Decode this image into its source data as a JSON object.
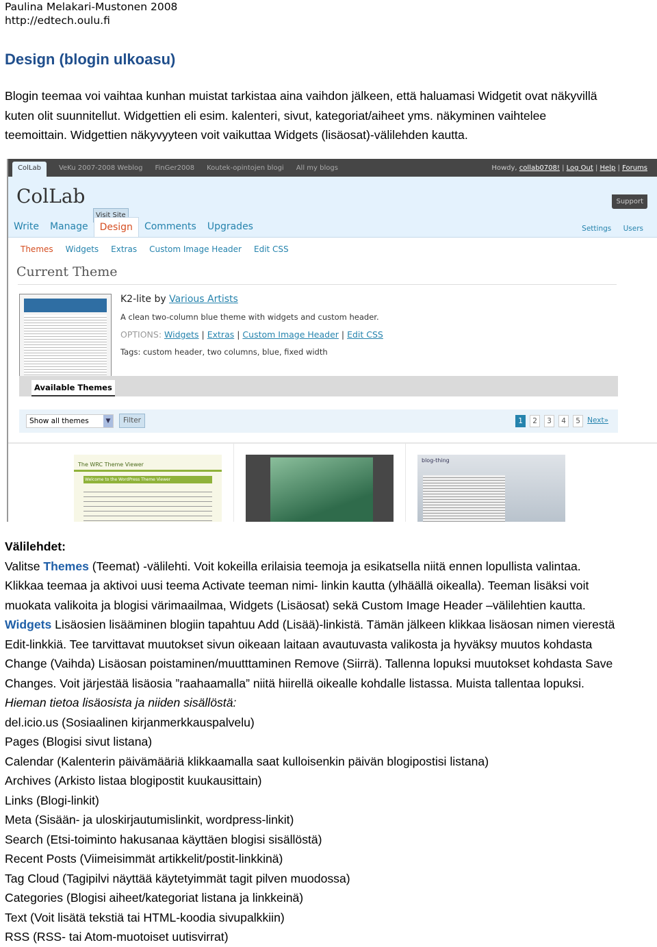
{
  "header": {
    "author": "Paulina Melakari-Mustonen 2008",
    "url": "http://edtech.oulu.fi"
  },
  "title": "Design (blogin ulkoasu)",
  "intro": [
    "Blogin teemaa voi vaihtaa kunhan muistat tarkistaa aina vaihdon jälkeen, että haluamasi Widgetit ovat näkyvillä",
    "kuten olit suunnitellut. Widgettien eli esim. kalenteri, sivut, kategoriat/aiheet yms. näkyminen vaihtelee",
    "teemoittain. Widgettien näkyvyyteen voit vaikuttaa Widgets (lisäosat)-välilehden kautta."
  ],
  "screenshot": {
    "topbar": {
      "tabs": [
        "ColLab",
        "VeKu 2007-2008 Weblog",
        "FinGer2008",
        "Koutek-opintojen blogi",
        "All my blogs"
      ],
      "howdy": "Howdy,",
      "user": "collab0708!",
      "logout": "Log Out",
      "help": "Help",
      "forums": "Forums",
      "support": "Support"
    },
    "logo": "ColLab",
    "visit_site": "Visit Site",
    "menu": [
      "Write",
      "Manage",
      "Design",
      "Comments",
      "Upgrades"
    ],
    "menu_right": [
      "Settings",
      "Users"
    ],
    "submenu": [
      "Themes",
      "Widgets",
      "Extras",
      "Custom Image Header",
      "Edit CSS"
    ],
    "current_theme_heading": "Current Theme",
    "theme": {
      "name": "K2-lite by",
      "author": "Various Artists",
      "description": "A clean two-column blue theme with widgets and custom header.",
      "options_label": "OPTIONS:",
      "options": [
        "Widgets",
        "Extras",
        "Custom Image Header",
        "Edit CSS"
      ],
      "tags": "Tags: custom header, two columns, blue, fixed width"
    },
    "available_tab": "Available Themes",
    "filter_select": "Show all themes",
    "filter_button": "Filter",
    "pages": [
      "1",
      "2",
      "3",
      "4",
      "5"
    ],
    "current_page": "1",
    "next": "Next»",
    "previews": [
      "The WRC Theme Viewer",
      "",
      "blog-thing"
    ]
  },
  "section_heading": "Välilehdet:",
  "body": {
    "l1a": "Valitse ",
    "l1b": "Themes",
    "l1c": " (Teemat) -välilehti. Voit kokeilla erilaisia teemoja ja esikatsella niitä ennen lopullista valintaa.",
    "l2": "Klikkaa teemaa ja aktivoi uusi teema Activate teeman nimi- linkin kautta (ylhäällä oikealla). Teeman lisäksi voit",
    "l3": "muokata valikoita ja blogisi värimaailmaa, Widgets (Lisäosat) sekä Custom Image Header –välilehtien kautta.",
    "l4a": "Widgets",
    "l4b": " Lisäosien lisääminen blogiin tapahtuu Add (Lisää)-linkistä. Tämän jälkeen klikkaa lisäosan nimen vierestä",
    "l5": "Edit-linkkiä. Tee tarvittavat muutokset sivun oikeaan laitaan avautuvasta valikosta ja hyväksy muutos kohdasta",
    "l6": "Change (Vaihda) Lisäosan poistaminen/muutttaminen Remove (Siirrä). Tallenna lopuksi muutokset kohdasta Save",
    "l7": "Changes. Voit järjestää lisäosia ”raahaamalla” niitä hiirellä oikealle kohdalle listassa. Muista tallentaa lopuksi.",
    "italic": "Hieman tietoa lisäosista ja niiden sisällöstä:",
    "widgets": [
      "del.icio.us (Sosiaalinen kirjanmerkkauspalvelu)",
      "Pages (Blogisi sivut listana)",
      "Calendar (Kalenterin päivämääriä klikkaamalla saat kulloisenkin päivän blogipostisi listana)",
      "Archives (Arkisto listaa blogipostit kuukausittain)",
      "Links (Blogi-linkit)",
      "Meta (Sisään- ja uloskirjautumislinkit, wordpress-linkit)",
      "Search (Etsi-toiminto hakusanaa käyttäen blogisi sisällöstä)",
      "Recent Posts (Viimeisimmät artikkelit/postit-linkkinä)",
      "Tag Cloud (Tagipilvi näyttää käytetyimmät tagit pilven muodossa)",
      "Categories (Blogisi aiheet/kategoriat listana ja linkkeinä)",
      "Text (Voit lisätä tekstiä tai HTML-koodia sivupalkkiin)",
      "RSS (RSS- tai Atom-muotoiset uutisvirrat)"
    ]
  }
}
